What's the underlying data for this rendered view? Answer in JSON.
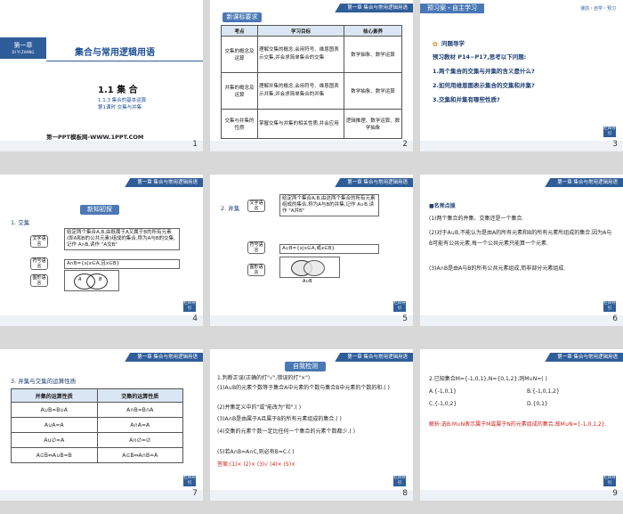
{
  "slide_numbers": [
    "1",
    "2",
    "3",
    "4",
    "5",
    "6",
    "7",
    "8",
    "9"
  ],
  "header_text": "第一章  集合与常用逻辑用语",
  "nav_label": "栏目导引",
  "s1": {
    "chapter_tag": "第一章",
    "chapter_pinyin": "DI YI ZHANG",
    "title": "集合与常用逻辑用语",
    "section": "1.1  集 合",
    "subsection": "1.1.3  集合的基本运算",
    "lesson": "第1课时  交集与并集",
    "watermark": "第一PPT模板网-WWW.1PPT.COM"
  },
  "s2": {
    "badge": "新课标要求",
    "headers": [
      "考点",
      "学习目标",
      "核心素养"
    ],
    "rows": [
      [
        "交集的概念及运算",
        "理解交集的概念,会用符号、维恩图表示交集,并会求简单集合的交集",
        "数学抽象、数学运算"
      ],
      [
        "并集的概念及运算",
        "理解并集的概念,会用符号、维恩图表示并集,并会求简单集合的并集",
        "数学抽象、数学运算"
      ],
      [
        "交集与并集的性质",
        "掌握交集与并集的相关性质,并会应用",
        "逻辑推理、数学运算、数学抽象"
      ]
    ]
  },
  "s3": {
    "badge": "预习案・自主学习",
    "top_right": "课前・自学・预习",
    "heading": "问题导学",
    "intro": "预习教材 P14~P17,思考以下问题:",
    "questions": [
      "1.两个集合的交集与并集的含义是什么?",
      "2.如何用维恩图表示集合的交集和并集?",
      "3.交集和并集有哪些性质?"
    ]
  },
  "s4": {
    "badge": "新知初探",
    "heading": "1. 交集",
    "lang_labels": [
      "文字语言",
      "符号语言",
      "图形语言"
    ],
    "text_def": "给定两个集合A,B,由既属于A又属于B的所有元素(即A和B的公共元素)组成的集合,称为A与B的交集,记作 A∩B,读作 \"A交B\"",
    "symbol_def": "A∩B={x|x∈A,且x∈B}",
    "venn_a": "A",
    "venn_b": "B"
  },
  "s5": {
    "heading": "2. 并集",
    "lang_labels": [
      "文字语言",
      "符号语言",
      "图形语言"
    ],
    "text_def": "给定两个集合A,B,由这两个集合的所有元素组成的集合,称为A与B的并集,记作 A∪B,读作 \"A并B\"",
    "symbol_def": "A∪B={x|x∈A,或x∈B}",
    "venn_caption": "A∪B"
  },
  "s6": {
    "heading": "■名师点拨",
    "lines": [
      "(1)两个集合的并集、交集还是一个集合.",
      "(2)对于A∪B,不能认为是由A的所有元素和B的所有元素所组成的集合.因为A与B可能有公共元素,每一个公共元素只能算一个元素.",
      "(3)A∩B是由A与B的所有公共元素组成,而非部分元素组成."
    ]
  },
  "s7": {
    "heading": "3. 并集与交集的运算性质",
    "headers": [
      "并集的运算性质",
      "交集的运算性质"
    ],
    "rows": [
      [
        "A∪B=B∪A",
        "A∩B=B∩A"
      ],
      [
        "A∪A=A",
        "A∩A=A"
      ],
      [
        "A∪∅=A",
        "A∩∅=∅"
      ],
      [
        "A⊆B⇔A∪B=B",
        "A⊆B⇔A∩B=A"
      ]
    ]
  },
  "s8": {
    "badge": "自我检测",
    "lines": [
      "1.判断正误(正确的打\"√\",错误的打\"×\")",
      "(1)A∪B的元素个数等于集合A中元素的个数与集合B中元素的个数的和.(  )",
      "(2)并集定义中的\"或\"能改为\"和\".(  )",
      "(3)A∩B是由属于A且属于B的所有元素组成的集合.(  )",
      "(4)交集的元素个数一定比任何一个集合的元素个数都少.(  )",
      "(5)若A∩B=A∩C,则必有B=C.(  )"
    ],
    "answer": "答案:(1)×  (2)×  (3)√  (4)×  (5)×"
  },
  "s9": {
    "question": "2.已知集合M={-1,0,1},N={0,1,2},则M∪N=(  )",
    "options": [
      "A.{-1,0,1}",
      "B.{-1,0,1,2}",
      "C.{-1,0,2}",
      "D.{0,1}"
    ],
    "solution": "解析:选B.M∪N表示属于M或属于N的元素组成的集合,故M∪N={-1,0,1,2}."
  }
}
